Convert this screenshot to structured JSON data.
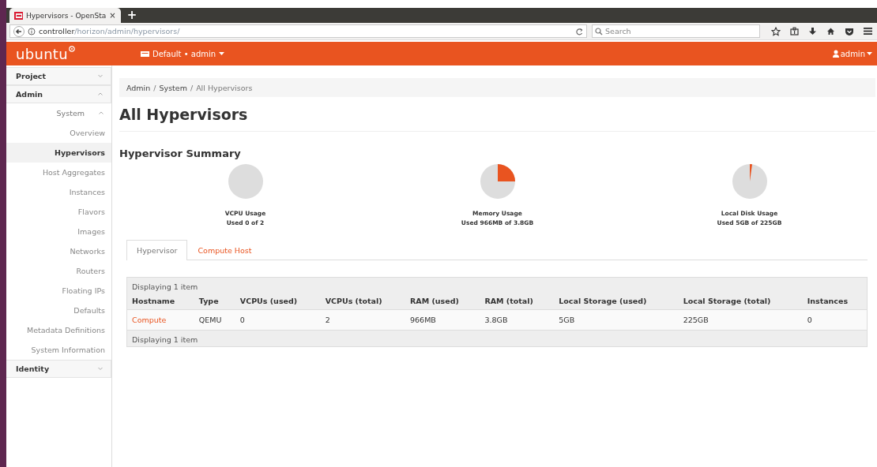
{
  "browser": {
    "tab_title": "Hypervisors - OpenSta",
    "tab_close": "×",
    "new_tab": "+",
    "url_host": "controller",
    "url_path": "/horizon/admin/hypervisors/",
    "search": {
      "placeholder": "Search"
    }
  },
  "navbar": {
    "logo": "ubuntu",
    "project_menu": "Default • admin",
    "user_menu": "admin"
  },
  "sidebar": [
    {
      "label": "Project",
      "expanded": false
    },
    {
      "label": "Admin",
      "expanded": true,
      "children": [
        {
          "label": "System",
          "expanded": true,
          "children": [
            {
              "label": "Overview",
              "selected": false
            },
            {
              "label": "Hypervisors",
              "selected": true
            },
            {
              "label": "Host Aggregates",
              "selected": false
            },
            {
              "label": "Instances",
              "selected": false
            },
            {
              "label": "Flavors",
              "selected": false
            },
            {
              "label": "Images",
              "selected": false
            },
            {
              "label": "Networks",
              "selected": false
            },
            {
              "label": "Routers",
              "selected": false
            },
            {
              "label": "Floating IPs",
              "selected": false
            },
            {
              "label": "Defaults",
              "selected": false
            },
            {
              "label": "Metadata Definitions",
              "selected": false
            },
            {
              "label": "System Information",
              "selected": false
            }
          ]
        }
      ]
    },
    {
      "label": "Identity",
      "expanded": false
    }
  ],
  "breadcrumb": {
    "separator": "/",
    "items": [
      "Admin",
      "System",
      "All Hypervisors"
    ]
  },
  "page_title": "All Hypervisors",
  "summary": {
    "title": "Hypervisor Summary",
    "gauges": [
      {
        "label": "VCPU Usage",
        "reading": "Used 0 of 2"
      },
      {
        "label": "Memory Usage",
        "reading": "Used 966MB of 3.8GB"
      },
      {
        "label": "Local Disk Usage",
        "reading": "Used 5GB of 225GB"
      }
    ]
  },
  "tabs": [
    {
      "label": "Hypervisor",
      "selected": true
    },
    {
      "label": "Compute Host",
      "selected": false
    }
  ],
  "table": {
    "caption": "Displaying 1 item",
    "footer": "Displaying 1 item",
    "columns": [
      "Hostname",
      "Type",
      "VCPUs (used)",
      "VCPUs (total)",
      "RAM (used)",
      "RAM (total)",
      "Local Storage (used)",
      "Local Storage (total)",
      "Instances"
    ],
    "rows": [
      [
        "Compute",
        "QEMU",
        "0",
        "2",
        "966MB",
        "3.8GB",
        "5GB",
        "225GB",
        "0"
      ]
    ]
  }
}
